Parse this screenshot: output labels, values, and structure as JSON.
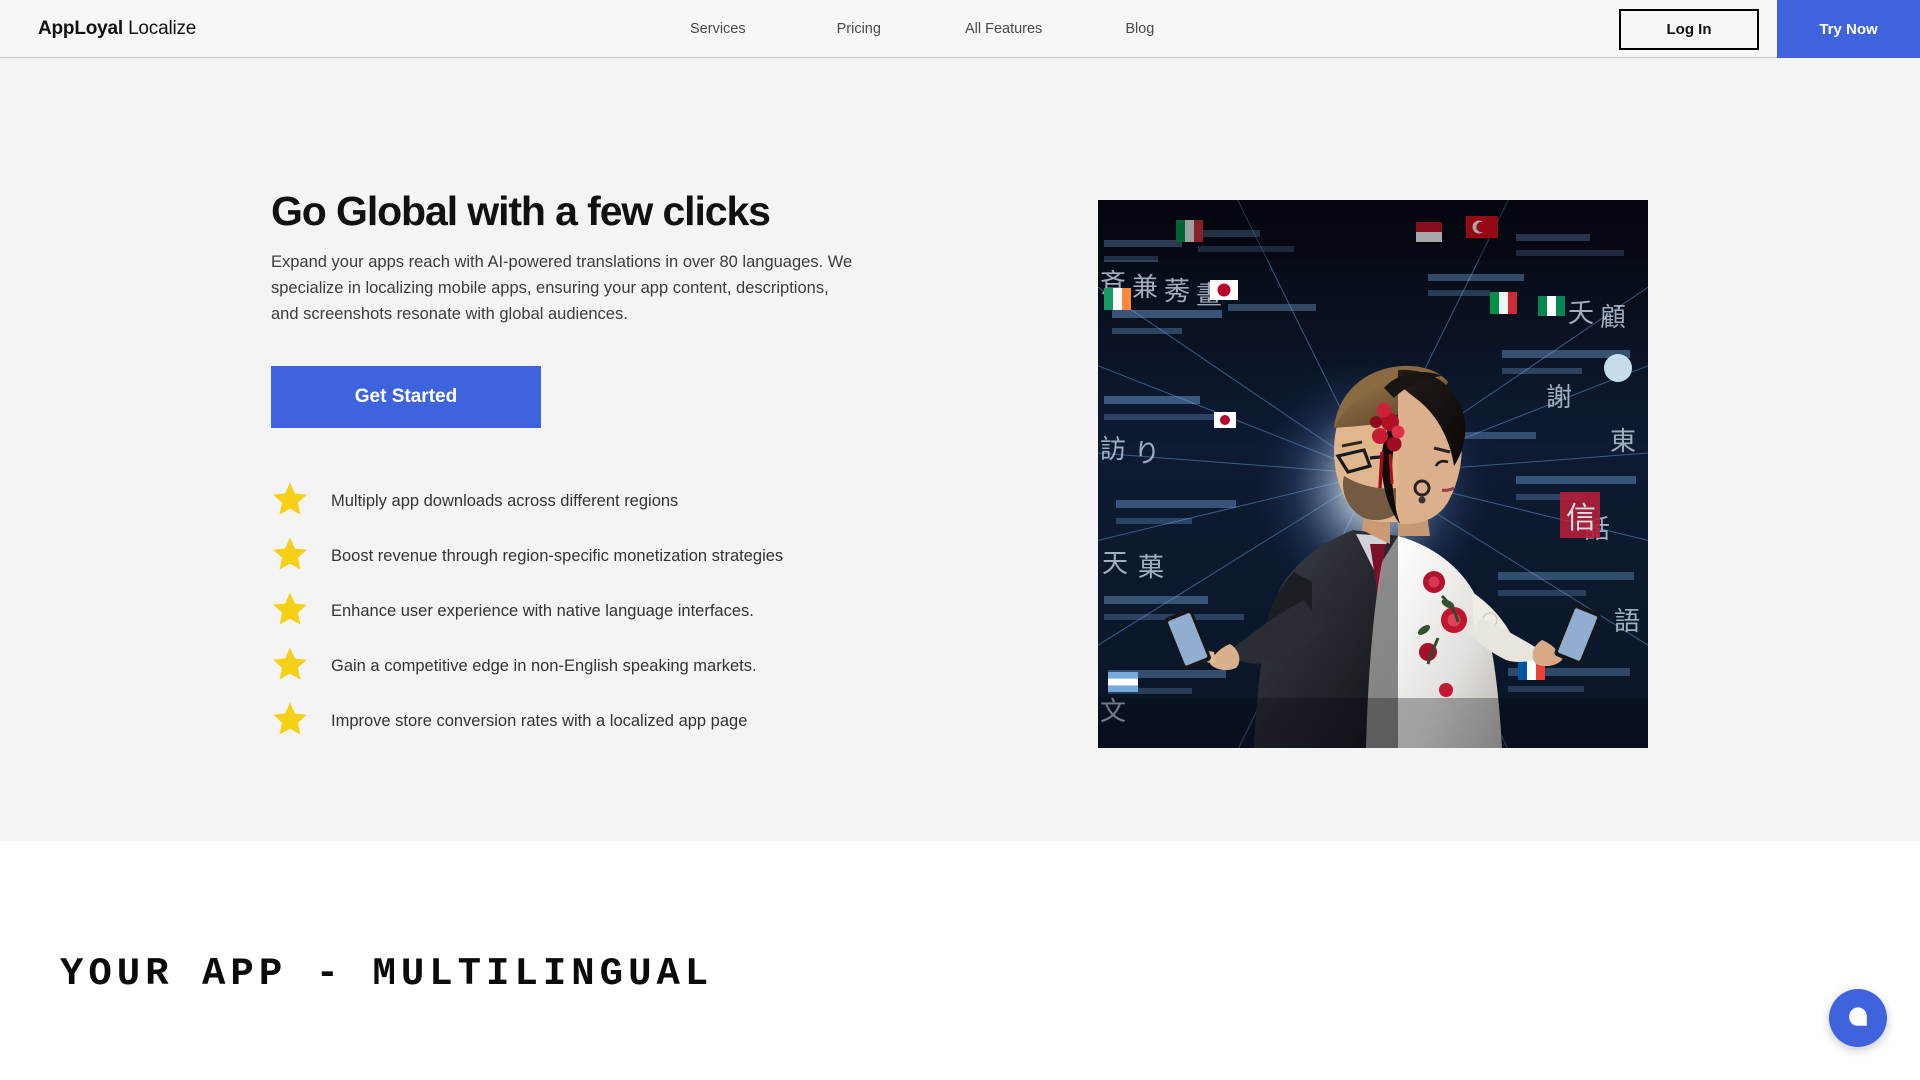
{
  "header": {
    "brand": {
      "strong": "AppLoyal",
      "light": "Localize"
    },
    "nav": [
      {
        "label": "Services",
        "name": "nav-link-services"
      },
      {
        "label": "Pricing",
        "name": "nav-link-pricing"
      },
      {
        "label": "All Features",
        "name": "nav-link-all-features"
      },
      {
        "label": "Blog",
        "name": "nav-link-blog"
      }
    ],
    "login_label": "Log In",
    "try_now_label": "Try Now"
  },
  "hero": {
    "title": "Go Global with a few clicks",
    "subtitle": "Expand your apps reach with AI-powered translations in over 80 languages. We specialize in localizing mobile apps, ensuring your app content, descriptions, and screenshots resonate with global audiences.",
    "cta_label": "Get Started",
    "benefits": [
      "Multiply app downloads across different regions",
      "Boost revenue through region-specific monetization strategies",
      "Enhance user experience with native language interfaces.",
      "Gain a competitive edge in non-English speaking markets.",
      "Improve store conversion rates with a localized app page"
    ],
    "image_alt": "Two people back to back using smartphones surrounded by multilingual text and national flags"
  },
  "multilingual_section": {
    "heading": "YOUR APP - MULTILINGUAL"
  },
  "chat": {
    "label": "Open chat"
  },
  "colors": {
    "accent_blue": "#3f63dd",
    "star_gold": "#f5d016",
    "hero_bg": "#f4f4f4",
    "header_bg": "#f7f7f7",
    "text_dark": "#111111",
    "text_body": "#3c3c3c"
  }
}
